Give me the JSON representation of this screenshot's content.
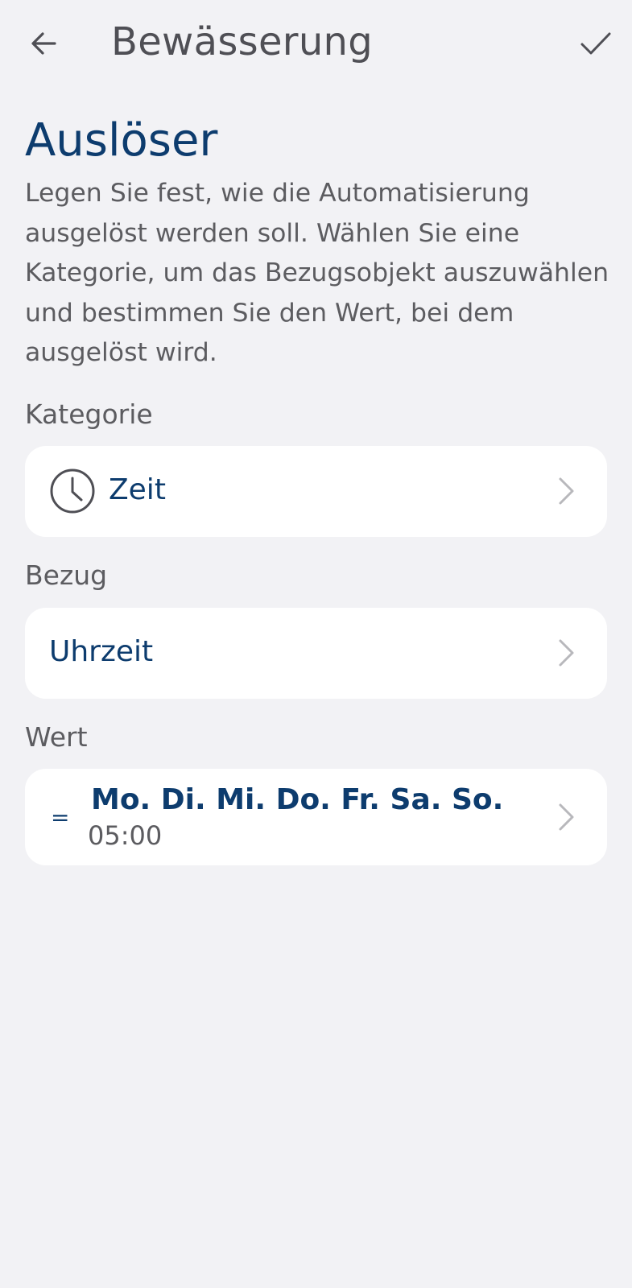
{
  "header": {
    "title": "Bewässerung",
    "back_icon": "arrow-left-icon",
    "confirm_icon": "check-icon"
  },
  "section": {
    "title": "Auslöser",
    "description": "Legen Sie fest, wie die Automatisierung ausgelöst werden soll. Wählen Sie eine Kategorie, um das Bezugsobjekt auszuwählen und bestimmen Sie den Wert, bei dem ausgelöst wird."
  },
  "kategorie": {
    "label": "Kategorie",
    "value": "Zeit",
    "icon": "clock-icon"
  },
  "bezug": {
    "label": "Bezug",
    "value": "Uhrzeit"
  },
  "wert": {
    "label": "Wert",
    "operator": "=",
    "days": "Mo. Di. Mi. Do. Fr. Sa. So.",
    "time": "05:00"
  },
  "colors": {
    "background": "#f2f2f5",
    "card": "#ffffff",
    "accent": "#0d3c6e",
    "text_gray": "#5c5c60"
  }
}
